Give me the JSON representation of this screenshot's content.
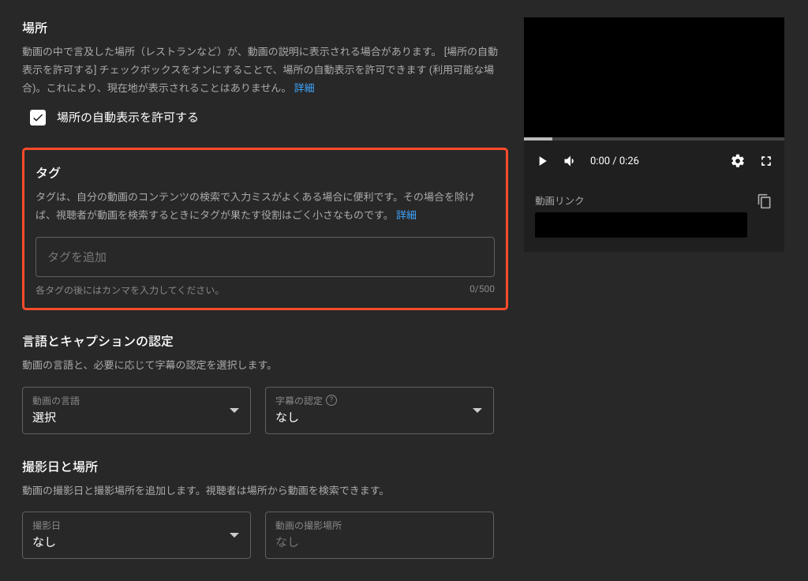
{
  "location": {
    "title": "場所",
    "desc_line1": "動画の中で言及した場所（レストランなど）が、動画の説明に表示される場合があります。",
    "desc_line2": "[場所の自動表示を許可する] チェックボックスをオンにすることで、場所の自動表示を許可できます (利用可能な場合)。これにより、現在地が表示されることはありません。",
    "learn_more": "詳細",
    "checkbox_label": "場所の自動表示を許可する",
    "checkbox_checked": true
  },
  "tags": {
    "title": "タグ",
    "desc": "タグは、自分の動画のコンテンツの検索で入力ミスがよくある場合に便利です。その場合を除けば、視聴者が動画を検索するときにタグが果たす役割はごく小さなものです。",
    "learn_more": "詳細",
    "placeholder": "タグを追加",
    "hint": "各タグの後にはカンマを入力してください。",
    "counter": "0/500"
  },
  "lang": {
    "title": "言語とキャプションの認定",
    "desc": "動画の言語と、必要に応じて字幕の認定を選択します。",
    "language_label": "動画の言語",
    "language_value": "選択",
    "cert_label": "字幕の認定",
    "cert_value": "なし"
  },
  "rec": {
    "title": "撮影日と場所",
    "desc": "動画の撮影日と撮影場所を追加します。視聴者は場所から動画を検索できます。",
    "date_label": "撮影日",
    "date_value": "なし",
    "place_label": "動画の撮影場所",
    "place_value": "なし"
  },
  "preview": {
    "time": "0:00 / 0:26",
    "link_label": "動画リンク"
  }
}
